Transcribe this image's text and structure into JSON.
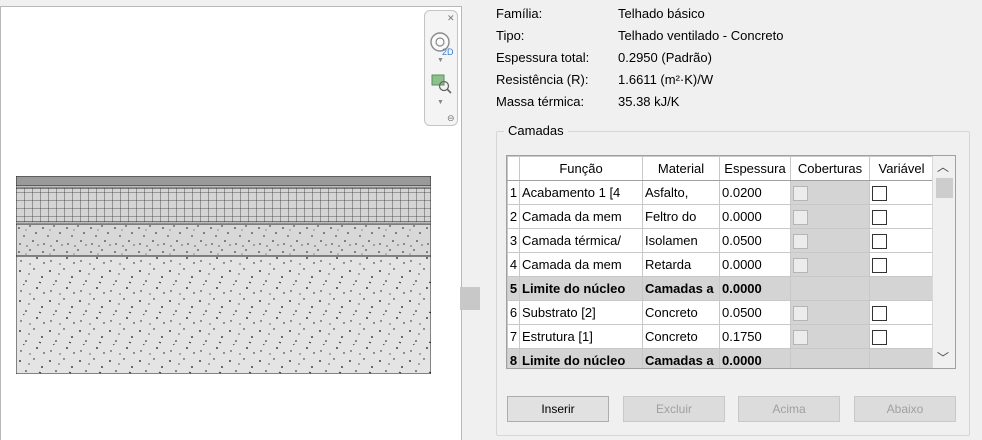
{
  "properties": [
    {
      "label": "Família:",
      "value": "Telhado básico"
    },
    {
      "label": "Tipo:",
      "value": "Telhado ventilado - Concreto"
    },
    {
      "label": "Espessura total:",
      "value": "0.2950 (Padrão)"
    },
    {
      "label": "Resistência (R):",
      "value": "1.6611 (m²·K)/W"
    },
    {
      "label": "Massa térmica:",
      "value": "35.38 kJ/K"
    }
  ],
  "layers": {
    "title": "Camadas",
    "columns": [
      "",
      "Função",
      "Material",
      "Espessura",
      "Coberturas",
      "Variável"
    ],
    "rows": [
      {
        "num": "1",
        "function": "Acabamento 1 [4",
        "material": "Asfalto,",
        "thickness": "0.0200",
        "core": false
      },
      {
        "num": "2",
        "function": "Camada da mem",
        "material": "Feltro do",
        "thickness": "0.0000",
        "core": false
      },
      {
        "num": "3",
        "function": "Camada térmica/",
        "material": "Isolamen",
        "thickness": "0.0500",
        "core": false
      },
      {
        "num": "4",
        "function": "Camada da mem",
        "material": "Retarda",
        "thickness": "0.0000",
        "core": false
      },
      {
        "num": "5",
        "function": "Limite do núcleo",
        "material": "Camadas a",
        "thickness": "0.0000",
        "core": true
      },
      {
        "num": "6",
        "function": "Substrato [2]",
        "material": "Concreto",
        "thickness": "0.0500",
        "core": false
      },
      {
        "num": "7",
        "function": "Estrutura [1]",
        "material": "Concreto",
        "thickness": "0.1750",
        "core": false
      },
      {
        "num": "8",
        "function": "Limite do núcleo",
        "material": "Camadas a",
        "thickness": "0.0000",
        "core": true
      }
    ]
  },
  "buttons": {
    "insert": "Inserir",
    "delete": "Excluir",
    "up": "Acima",
    "down": "Abaixo"
  },
  "nav": {
    "view_label": "2D",
    "icons": [
      "steering-wheel-icon",
      "zoom-region-icon"
    ]
  }
}
